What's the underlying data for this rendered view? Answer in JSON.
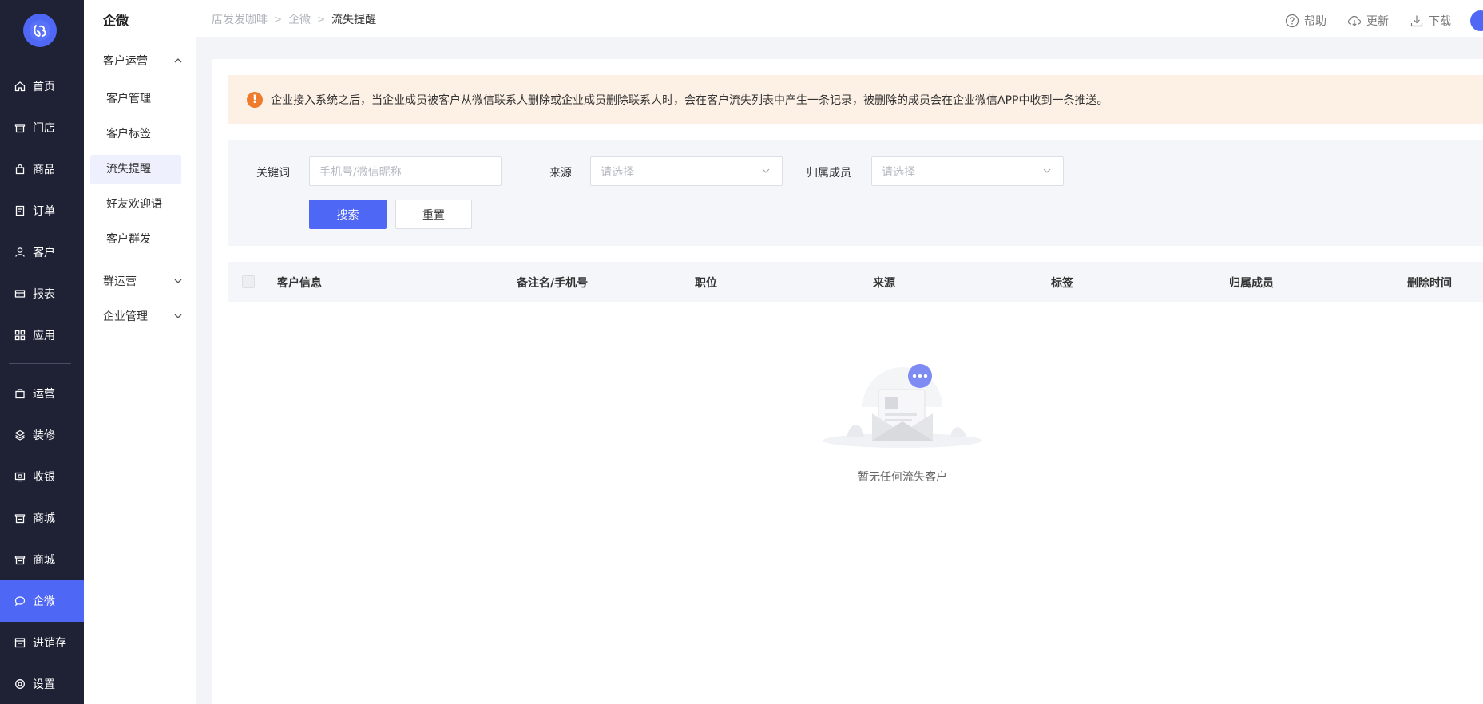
{
  "nav": {
    "items": [
      {
        "label": "首页",
        "icon": "home-icon"
      },
      {
        "label": "门店",
        "icon": "store-icon"
      },
      {
        "label": "商品",
        "icon": "bag-icon"
      },
      {
        "label": "订单",
        "icon": "order-icon"
      },
      {
        "label": "客户",
        "icon": "user-icon"
      },
      {
        "label": "报表",
        "icon": "report-icon"
      },
      {
        "label": "应用",
        "icon": "apps-icon"
      },
      {
        "label": "运营",
        "icon": "operation-icon"
      },
      {
        "label": "装修",
        "icon": "layers-icon"
      },
      {
        "label": "收银",
        "icon": "cashier-icon"
      },
      {
        "label": "商城",
        "icon": "mall-icon"
      },
      {
        "label": "商城",
        "icon": "mall-icon"
      },
      {
        "label": "企微",
        "icon": "chat-icon"
      },
      {
        "label": "进销存",
        "icon": "inventory-icon"
      },
      {
        "label": "设置",
        "icon": "gear-icon"
      }
    ],
    "active_index": 12,
    "accent": "#4e67f5",
    "background": "#1f2235"
  },
  "submenu": {
    "title": "企微",
    "groups": [
      {
        "label": "客户运营",
        "expanded": true
      },
      {
        "label": "群运营",
        "expanded": false
      },
      {
        "label": "企业管理",
        "expanded": false
      }
    ],
    "items": [
      "客户管理",
      "客户标签",
      "流失提醒",
      "好友欢迎语",
      "客户群发"
    ],
    "active_item": "流失提醒"
  },
  "header": {
    "breadcrumb": [
      "店发发咖啡",
      "企微",
      "流失提醒"
    ],
    "tools": [
      {
        "label": "帮助",
        "icon": "help-icon"
      },
      {
        "label": "更新",
        "icon": "cloud-download-icon"
      },
      {
        "label": "下载",
        "icon": "download-icon"
      }
    ]
  },
  "alert": {
    "text": "企业接入系统之后，当企业成员被客户从微信联系人删除或企业成员删除联系人时，会在客户流失列表中产生一条记录，被删除的成员会在企业微信APP中收到一条推送。",
    "color": "#ef7b2c"
  },
  "filter": {
    "keyword_label": "关键词",
    "keyword_placeholder": "手机号/微信昵称",
    "source_label": "来源",
    "source_placeholder": "请选择",
    "member_label": "归属成员",
    "member_placeholder": "请选择",
    "search_label": "搜索",
    "reset_label": "重置"
  },
  "table": {
    "columns": [
      "客户信息",
      "备注名/手机号",
      "职位",
      "来源",
      "标签",
      "归属成员",
      "删除时间"
    ],
    "rows": []
  },
  "empty": {
    "text": "暂无任何流失客户"
  }
}
